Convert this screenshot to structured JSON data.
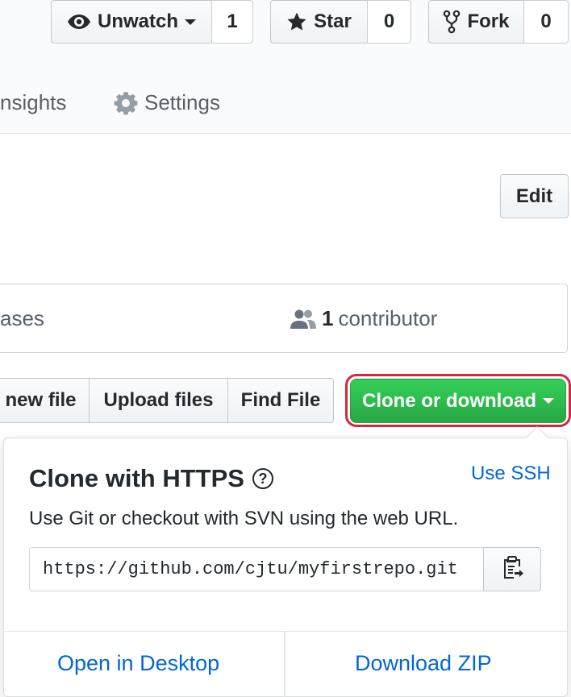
{
  "repo_actions": {
    "watch": {
      "label": "Unwatch",
      "count": "1",
      "icon": "eye-icon"
    },
    "star": {
      "label": "Star",
      "count": "0",
      "icon": "star-icon"
    },
    "fork": {
      "label": "Fork",
      "count": "0",
      "icon": "fork-icon"
    }
  },
  "tabs": [
    {
      "label": "nsights"
    },
    {
      "label": "Settings",
      "icon": "gear-icon"
    }
  ],
  "edit_button": "Edit",
  "summary": {
    "releases_label": "ases",
    "contributors_count": "1",
    "contributors_label": "contributor",
    "icon": "people-icon"
  },
  "file_actions": {
    "create_new_file": "new file",
    "upload_files": "Upload files",
    "find_file": "Find File"
  },
  "clone_button": {
    "label": "Clone or download"
  },
  "clone_popover": {
    "title": "Clone with HTTPS",
    "help_icon": "?",
    "use_ssh": "Use SSH",
    "description": "Use Git or checkout with SVN using the web URL.",
    "url": "https://github.com/cjtu/myfirstrepo.git",
    "open_desktop": "Open in Desktop",
    "download_zip": "Download ZIP"
  },
  "colors": {
    "accent_green": "#28a745",
    "link_blue": "#0366d6",
    "highlight_red": "#d7263d"
  }
}
